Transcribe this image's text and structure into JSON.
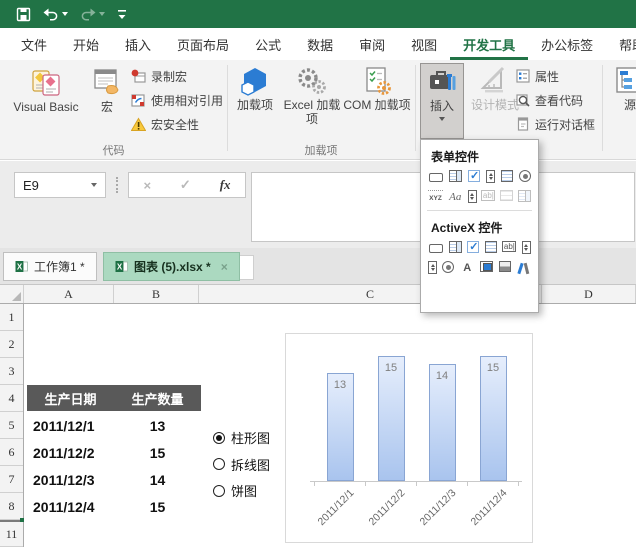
{
  "quick_access": {
    "save": "save",
    "undo": "undo",
    "redo": "redo",
    "customize": "customize-quick-access-toolbar"
  },
  "menu_tabs": {
    "items": [
      {
        "name": "file",
        "label": "文件",
        "active": false
      },
      {
        "name": "home",
        "label": "开始",
        "active": false
      },
      {
        "name": "insert",
        "label": "插入",
        "active": false
      },
      {
        "name": "page-layout",
        "label": "页面布局",
        "active": false
      },
      {
        "name": "formulas",
        "label": "公式",
        "active": false
      },
      {
        "name": "data",
        "label": "数据",
        "active": false
      },
      {
        "name": "review",
        "label": "审阅",
        "active": false
      },
      {
        "name": "view",
        "label": "视图",
        "active": false
      },
      {
        "name": "developer",
        "label": "开发工具",
        "active": true
      },
      {
        "name": "office-tab",
        "label": "办公标签",
        "active": false
      },
      {
        "name": "help",
        "label": "帮助",
        "active": false
      }
    ]
  },
  "ribbon": {
    "code_group": {
      "label": "代码",
      "visual_basic": "Visual Basic",
      "macros": "宏",
      "record_macro": "录制宏",
      "relative_refs": "使用相对引用",
      "macro_security": "宏安全性"
    },
    "addins_group": {
      "label": "加载项",
      "addins": "加载项",
      "excel_addins": "Excel 加载项",
      "com_addins": "COM 加载项"
    },
    "controls_group": {
      "insert": "插入",
      "design_mode": "设计模式",
      "properties": "属性",
      "view_code": "查看代码",
      "run_dialog": "运行对话框"
    },
    "xml_group": {
      "source": "源"
    }
  },
  "insert_dropdown": {
    "form_section_title": "表单控件",
    "activex_section_title": "ActiveX 控件",
    "form_icons": [
      [
        "form-button-icon",
        "form-combo-box-icon",
        "form-checkbox-icon",
        "form-spin-button-icon",
        "form-list-box-icon",
        "form-option-button-icon"
      ],
      [
        "form-label-icon",
        "form-text-aa-icon",
        "form-scroll-bar-icon",
        "form-text-field-icon-disabled",
        "form-group-box-icon-disabled",
        "form-drop-list-icon-disabled"
      ]
    ],
    "activex_icons": [
      [
        "ax-command-button-icon",
        "ax-combo-box-icon",
        "ax-checkbox-icon",
        "ax-list-box-icon",
        "ax-text-box-icon",
        "ax-spin-button-icon"
      ],
      [
        "ax-scroll-bar-icon",
        "ax-option-button-icon",
        "ax-label-icon",
        "ax-image-icon",
        "ax-toggle-button-icon",
        "ax-more-controls-icon"
      ]
    ],
    "glyphs": {
      "form-label-icon": "XYZ",
      "form-text-aa-icon": "Aa",
      "form-text-field-icon-disabled": "ab|",
      "ax-text-box-icon": "ab|",
      "ax-label-icon": "A"
    }
  },
  "formula_bar": {
    "name_box": "E9",
    "cancel": "×",
    "enter": "✓",
    "fx": "fx"
  },
  "workbook_tabs": {
    "items": [
      {
        "name": "workbook1",
        "label": "工作簿1 *",
        "active": false
      },
      {
        "name": "chart-5-xlsx",
        "label": "图表 (5).xlsx *",
        "active": true,
        "close": "×"
      }
    ]
  },
  "grid": {
    "columns": [
      "A",
      "B",
      "C",
      "D"
    ],
    "rows": [
      "1",
      "2",
      "3",
      "4",
      "5",
      "6",
      "7",
      "8",
      "11"
    ]
  },
  "table": {
    "headers": [
      "生产日期",
      "生产数量"
    ],
    "rows": [
      [
        "2011/12/1",
        "13"
      ],
      [
        "2011/12/2",
        "15"
      ],
      [
        "2011/12/3",
        "14"
      ],
      [
        "2011/12/4",
        "15"
      ]
    ]
  },
  "chart_options": {
    "items": [
      {
        "label": "柱形图",
        "selected": true
      },
      {
        "label": "拆线图",
        "selected": false
      },
      {
        "label": "饼图",
        "selected": false
      }
    ]
  },
  "chart_data": {
    "type": "bar",
    "categories": [
      "2011/12/1",
      "2011/12/2",
      "2011/12/3",
      "2011/12/4"
    ],
    "values": [
      13,
      15,
      14,
      15
    ],
    "series": [
      {
        "name": "生产数量",
        "values": [
          13,
          15,
          14,
          15
        ]
      }
    ],
    "data_labels": [
      13,
      15,
      14,
      15
    ],
    "title": "",
    "xlabel": "",
    "ylabel": "",
    "ylim": [
      0,
      16
    ],
    "gridlines": false,
    "legend": false,
    "x_tick_rotation": -45,
    "bar_border": "#89a5d3",
    "bar_fill_top": "#e6eefc",
    "bar_fill_bottom": "#a9c4ee",
    "label_color": "#7f7f7f",
    "axis_color": "#c9c9c9"
  },
  "colors": {
    "titlebar_green": "#217346",
    "active_tab_green": "#217346",
    "table_header_bg": "#595959",
    "table_header_text": "#ffffff",
    "active_sheet_tab_bg": "#abd9c0"
  }
}
